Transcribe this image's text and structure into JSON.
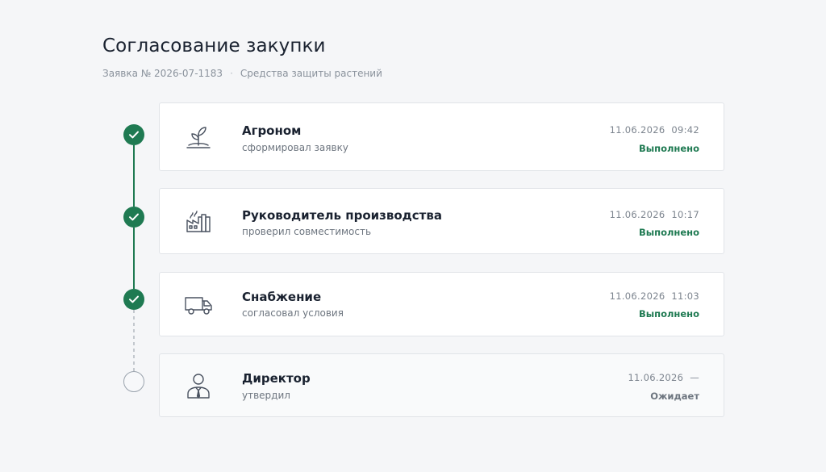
{
  "page": {
    "title": "Согласование закупки",
    "request": "Заявка № 2026-07-1183",
    "separator": "·",
    "category": "Средства защиты растений"
  },
  "colors": {
    "accent": "#1f7a52",
    "pending": "#9aa3ad"
  },
  "steps": [
    {
      "role": "Агроном",
      "action": "сформировал заявку",
      "datetime": "11.06.2026  09:42",
      "status": "Выполнено",
      "state": "done",
      "icon": "sprout-icon"
    },
    {
      "role": "Руководитель производства",
      "action": "проверил совместимость",
      "datetime": "11.06.2026  10:17",
      "status": "Выполнено",
      "state": "done",
      "icon": "factory-icon"
    },
    {
      "role": "Снабжение",
      "action": "согласовал условия",
      "datetime": "11.06.2026  11:03",
      "status": "Выполнено",
      "state": "done",
      "icon": "truck-icon"
    },
    {
      "role": "Директор",
      "action": "утвердил",
      "datetime": "11.06.2026  —",
      "status": "Ожидает",
      "state": "pending",
      "icon": "person-icon"
    }
  ]
}
